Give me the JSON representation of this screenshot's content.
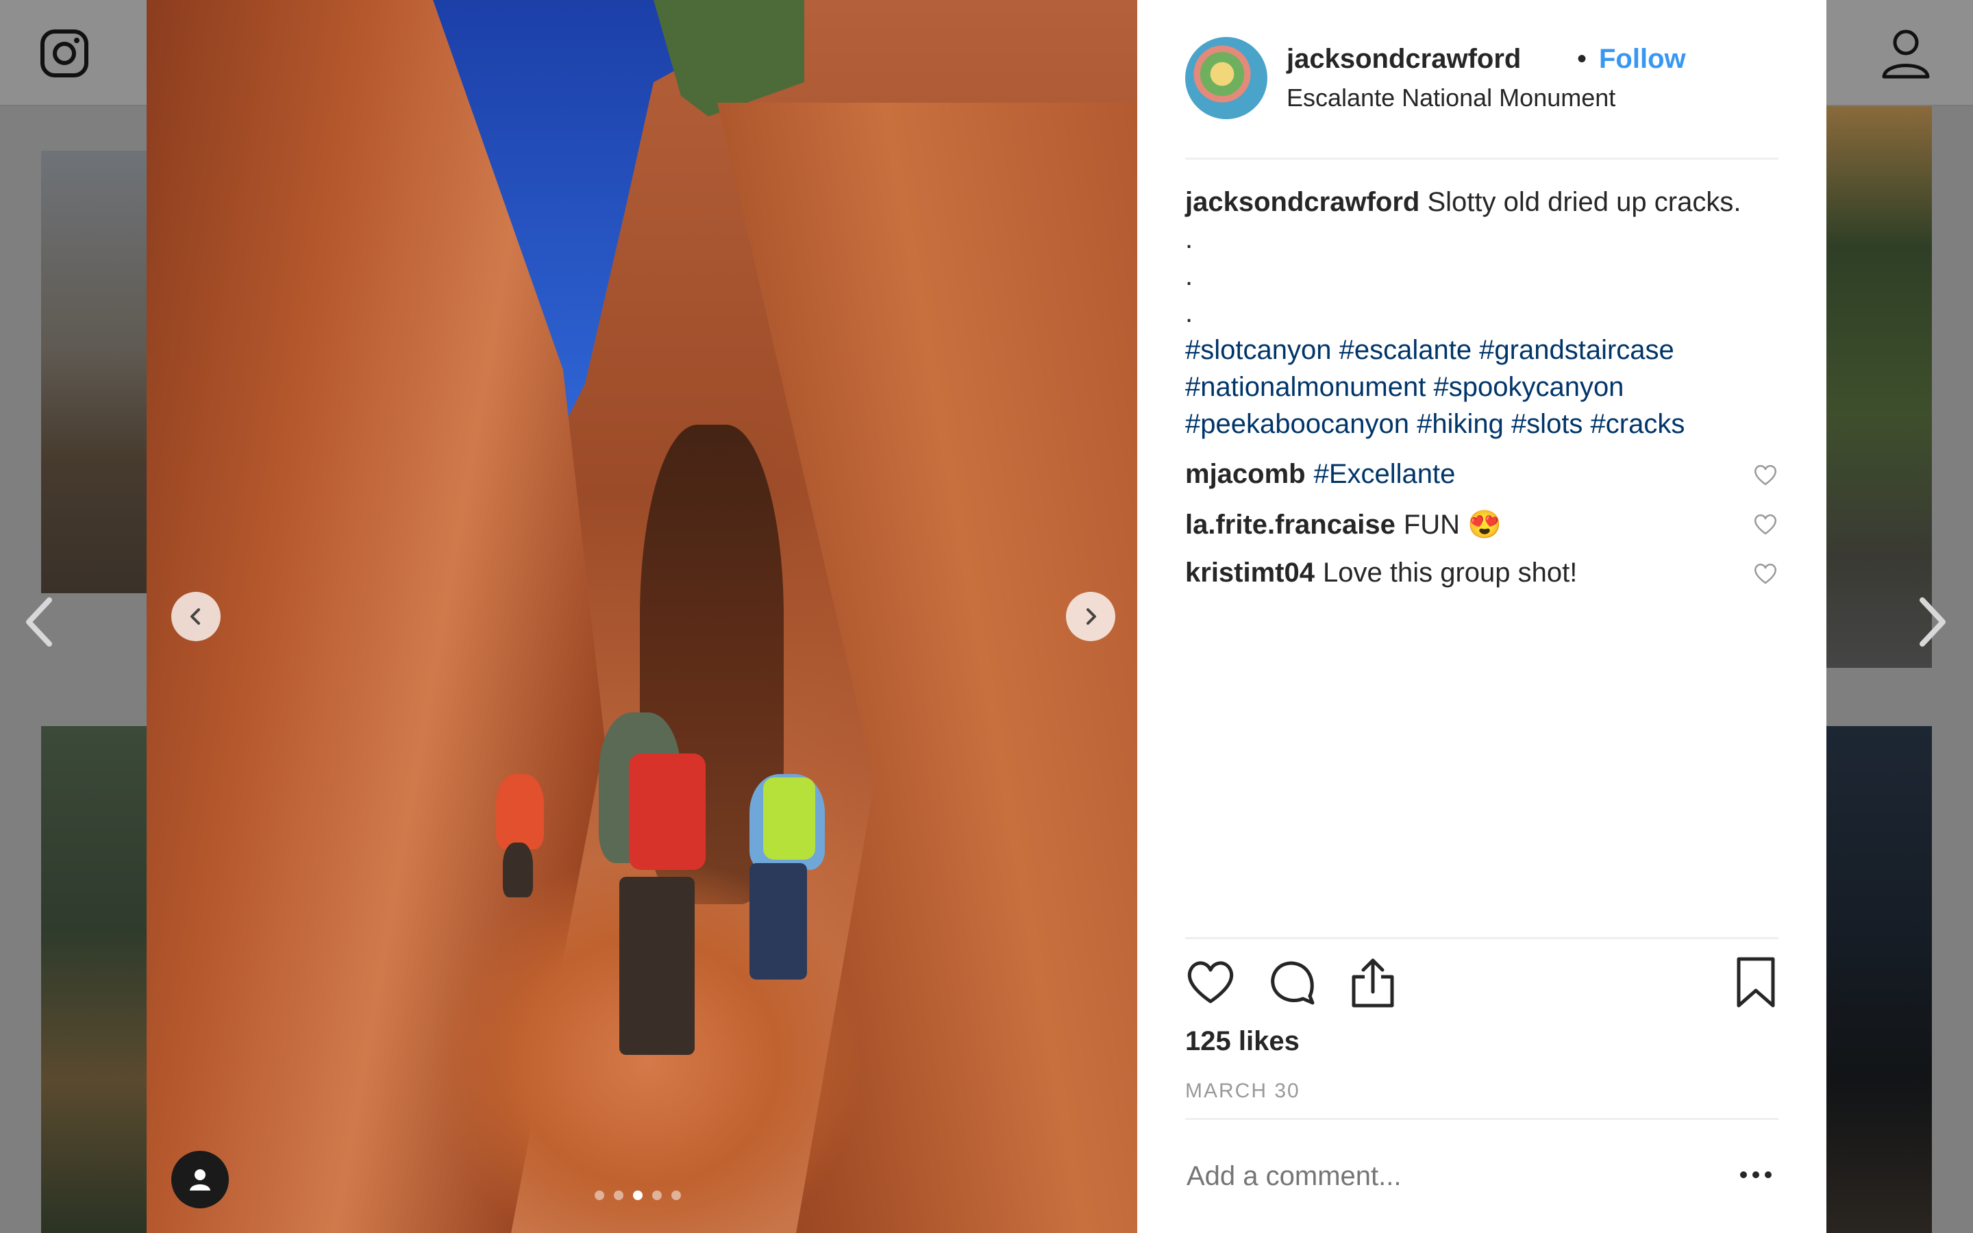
{
  "post": {
    "username": "jacksondcrawford",
    "separator": "•",
    "follow_label": "Follow",
    "location": "Escalante National Monument",
    "caption_text": "Slotty old dried up cracks.",
    "caption_dots": [
      ".",
      ".",
      "."
    ],
    "hashtags_line1": "#slotcanyon #escalante #grandstaircase",
    "hashtags_line2": "#nationalmonument #spookycanyon",
    "hashtags_line3": "#peekaboocanyon #hiking #slots #cracks",
    "comments": [
      {
        "user": "mjacomb",
        "text": "#Excellante",
        "text_is_hashtag": true
      },
      {
        "user": "la.frite.francaise",
        "text": "FUN 😍"
      },
      {
        "user": "kristimt04",
        "text": "Love this group shot!"
      }
    ],
    "likes": "125 likes",
    "date": "MARCH 30",
    "add_comment_placeholder": "Add a comment...",
    "carousel": {
      "count": 5,
      "active_index": 2
    }
  },
  "colors": {
    "follow": "#3897f0",
    "hashtag": "#003569",
    "text": "#262626",
    "muted": "#999999"
  },
  "icons": [
    "instagram-logo-icon",
    "profile-icon",
    "chevron-left-icon",
    "chevron-right-icon",
    "user-tag-icon",
    "heart-icon",
    "comment-icon",
    "share-icon",
    "bookmark-icon",
    "more-options-icon"
  ]
}
